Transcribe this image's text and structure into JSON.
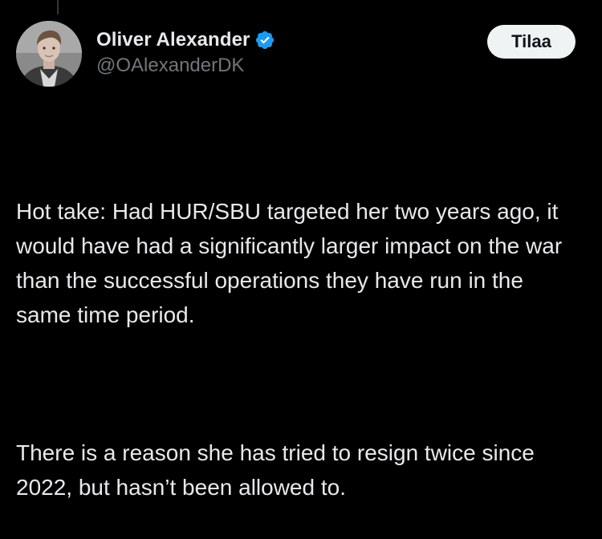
{
  "author": {
    "display_name": "Oliver Alexander",
    "handle": "@OAlexanderDK",
    "verified": true,
    "verified_color": "#1d9bf0"
  },
  "actions": {
    "subscribe_label": "Tilaa"
  },
  "post": {
    "paragraphs": [
      "Hot take: Had HUR/SBU targeted her two years ago, it would have had a significantly larger impact on the war than the successful operations they have run in the same time period.",
      "There is a reason she has tried to resign twice since 2022, but hasn’t been allowed to."
    ]
  },
  "theme": {
    "background": "#000000",
    "text": "#e7e9ea",
    "secondary_text": "#71767b"
  }
}
